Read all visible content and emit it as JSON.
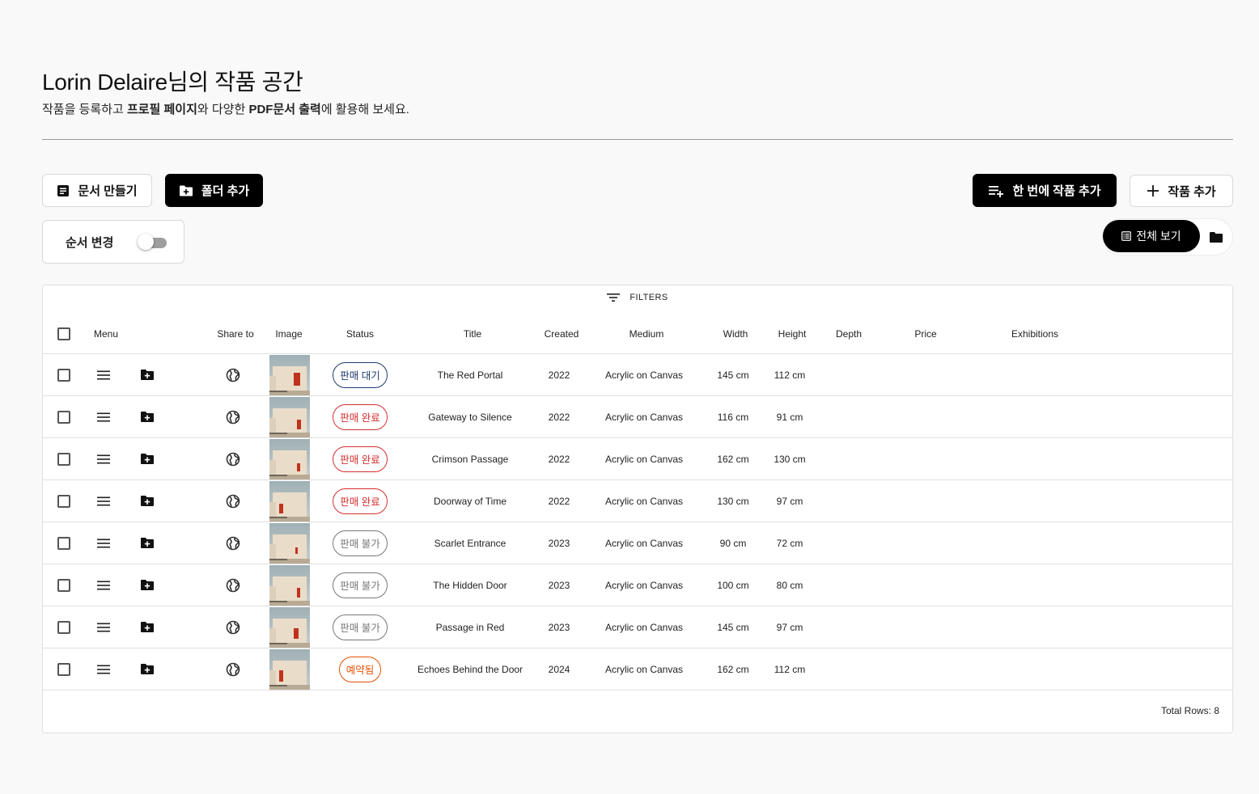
{
  "header": {
    "title": "Lorin Delaire님의 작품 공간",
    "subtitle_pre": "작품을 등록하고 ",
    "subtitle_b1": "프로필 페이지",
    "subtitle_mid": "와 다양한 ",
    "subtitle_b2": "PDF문서 출력",
    "subtitle_post": "에 활용해 보세요."
  },
  "toolbar": {
    "make_doc": "문서 만들기",
    "add_folder": "폴더 추가",
    "bulk_add": "한 번에 작품 추가",
    "add_work": "작품 추가",
    "reorder": "순서 변경",
    "reorder_on": false,
    "view_all": "전체 보기"
  },
  "table": {
    "filters": "FILTERS",
    "columns": [
      "Menu",
      "Share to",
      "Image",
      "Status",
      "Title",
      "Created",
      "Medium",
      "Width",
      "Height",
      "Depth",
      "Price",
      "Exhibitions"
    ],
    "rows": [
      {
        "status": "판매 대기",
        "status_type": "waiting",
        "title": "The Red Portal",
        "created": "2022",
        "medium": "Acrylic on Canvas",
        "width": "145 cm",
        "height": "112 cm"
      },
      {
        "status": "판매 완료",
        "status_type": "sold",
        "title": "Gateway to Silence",
        "created": "2022",
        "medium": "Acrylic on Canvas",
        "width": "116 cm",
        "height": "91 cm"
      },
      {
        "status": "판매 완료",
        "status_type": "sold",
        "title": "Crimson Passage",
        "created": "2022",
        "medium": "Acrylic on Canvas",
        "width": "162 cm",
        "height": "130 cm"
      },
      {
        "status": "판매 완료",
        "status_type": "sold",
        "title": "Doorway of Time",
        "created": "2022",
        "medium": "Acrylic on Canvas",
        "width": "130 cm",
        "height": "97 cm"
      },
      {
        "status": "판매 불가",
        "status_type": "nfs",
        "title": "Scarlet Entrance",
        "created": "2023",
        "medium": "Acrylic on Canvas",
        "width": "90 cm",
        "height": "72 cm"
      },
      {
        "status": "판매 불가",
        "status_type": "nfs",
        "title": "The Hidden Door",
        "created": "2023",
        "medium": "Acrylic on Canvas",
        "width": "100 cm",
        "height": "80 cm"
      },
      {
        "status": "판매 불가",
        "status_type": "nfs",
        "title": "Passage in Red",
        "created": "2023",
        "medium": "Acrylic on Canvas",
        "width": "145 cm",
        "height": "97 cm"
      },
      {
        "status": "예약됨",
        "status_type": "reserved",
        "title": "Echoes Behind the Door",
        "created": "2024",
        "medium": "Acrylic on Canvas",
        "width": "162 cm",
        "height": "112 cm"
      }
    ],
    "total": "Total Rows: 8"
  },
  "colors": {
    "waiting": "#1e3a6e",
    "sold": "#d32f2f",
    "nfs": "#777777",
    "reserved": "#e65100"
  }
}
